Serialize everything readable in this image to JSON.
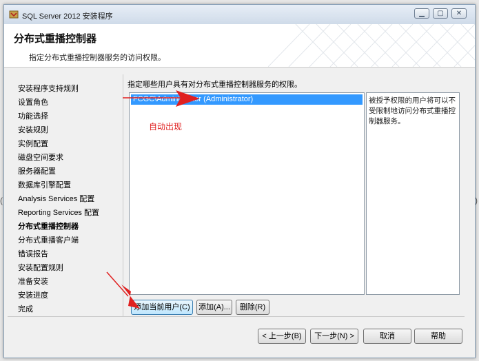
{
  "window": {
    "title": "SQL Server 2012 安装程序"
  },
  "header": {
    "title": "分布式重播控制器",
    "subtitle": "指定分布式重播控制器服务的访问权限。"
  },
  "nav": {
    "items": [
      "安装程序支持规则",
      "设置角色",
      "功能选择",
      "安装规则",
      "实例配置",
      "磁盘空间要求",
      "服务器配置",
      "数据库引擎配置",
      "Analysis Services 配置",
      "Reporting Services 配置",
      "分布式重播控制器",
      "分布式重播客户端",
      "错误报告",
      "安装配置规则",
      "准备安装",
      "安装进度",
      "完成"
    ],
    "active_index": 10
  },
  "main": {
    "description": "指定哪些用户具有对分布式重播控制器服务的权限。",
    "users": [
      "FCGC\\Administrator (Administrator)"
    ],
    "info_text": "被授予权限的用户将可以不受限制地访问分布式重播控制器服务。",
    "buttons": {
      "add_current": "添加当前用户(C)",
      "add": "添加(A)...",
      "remove": "删除(R)"
    }
  },
  "footer": {
    "back": "< 上一步(B)",
    "next": "下一步(N) >",
    "cancel": "取消",
    "help": "帮助"
  },
  "annotation": {
    "text": "自动出现",
    "color": "#e02020"
  }
}
